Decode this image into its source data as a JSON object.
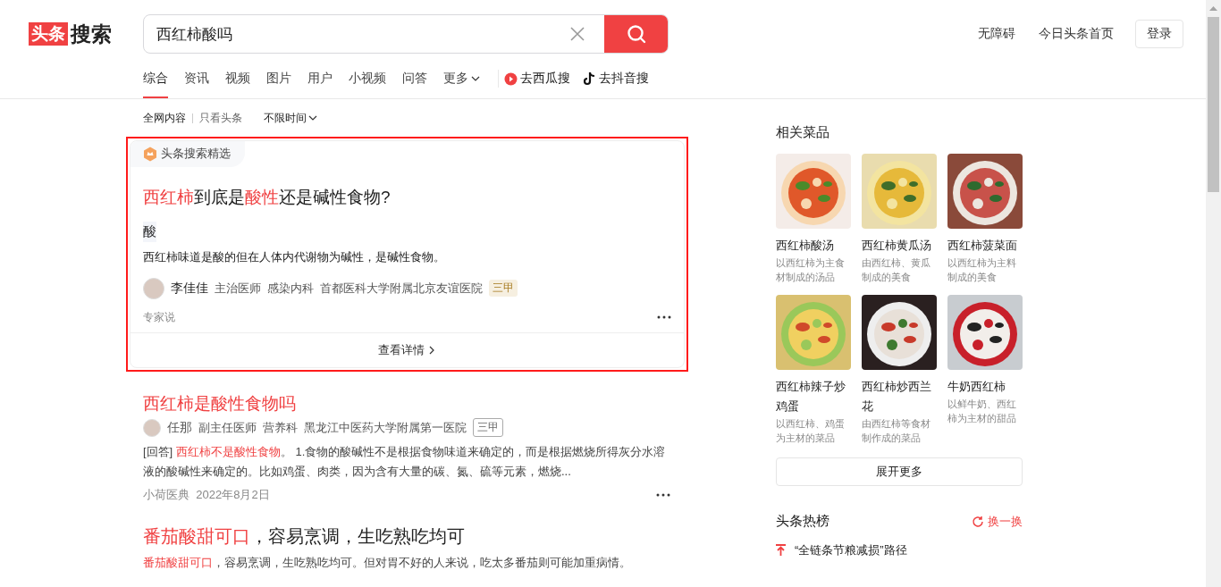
{
  "header": {
    "logo": {
      "badge": "头条",
      "text": "搜索"
    },
    "search": {
      "value": "西红柿酸吗"
    },
    "links": [
      "无障碍",
      "今日头条首页"
    ],
    "login": "登录"
  },
  "tabs": [
    {
      "label": "综合",
      "selected": true,
      "kind": "plain"
    },
    {
      "label": "资讯",
      "selected": false,
      "kind": "plain"
    },
    {
      "label": "视频",
      "selected": false,
      "kind": "plain"
    },
    {
      "label": "图片",
      "selected": false,
      "kind": "plain"
    },
    {
      "label": "用户",
      "selected": false,
      "kind": "plain"
    },
    {
      "label": "小视频",
      "selected": false,
      "kind": "plain"
    },
    {
      "label": "问答",
      "selected": false,
      "kind": "plain"
    },
    {
      "label": "更多",
      "selected": false,
      "kind": "dropdown"
    }
  ],
  "external_links": [
    {
      "label": "去西瓜搜",
      "kind": "xigua"
    },
    {
      "label": "去抖音搜",
      "kind": "douyin"
    }
  ],
  "filters": [
    {
      "label": "全网内容",
      "selected": true
    },
    {
      "label": "只看头条",
      "selected": false
    }
  ],
  "time_filter": "不限时间",
  "featured": {
    "highlighted": true,
    "badge": "头条搜索精选",
    "title": [
      {
        "text": "西红柿",
        "highlight": true
      },
      {
        "text": "到底是",
        "highlight": false
      },
      {
        "text": "酸性",
        "highlight": true
      },
      {
        "text": "还是碱性食物?",
        "highlight": false
      }
    ],
    "answer": "酸",
    "summary": "西红柿味道是酸的但在人体内代谢物为碱性，是碱性食物。",
    "author": {
      "name": "李佳佳",
      "title": "主治医师",
      "dept": "感染内科",
      "hospital": "首都医科大学附属北京友谊医院",
      "grade": "三甲"
    },
    "source": "专家说",
    "more": "查看详情"
  },
  "results": [
    {
      "kind": "answer",
      "title": [
        {
          "text": "西红柿是酸性食物吗",
          "highlight": true
        }
      ],
      "author": {
        "name": "任那",
        "title": "副主任医师",
        "dept": "营养科",
        "hospital": "黑龙江中医药大学附属第一医院",
        "grade": "三甲"
      },
      "snippet": [
        {
          "text": "[回答] ",
          "highlight": false
        },
        {
          "text": "西红柿不是酸性食物",
          "highlight": true
        },
        {
          "text": "。 1.食物的酸碱性不是根据食物味道来确定的，而是根据燃烧所得灰分水溶液的酸碱性来确定的。比如鸡蛋、肉类，因为含有大量的碳、氮、硫等元素，燃烧...",
          "highlight": false
        }
      ],
      "source": "小荷医典",
      "date": "2022年8月2日"
    },
    {
      "kind": "article",
      "title": [
        {
          "text": "番茄酸甜可口",
          "highlight": true
        },
        {
          "text": "，容易烹调，生吃熟吃均可",
          "highlight": false
        }
      ],
      "snippet": [
        {
          "text": "番茄酸甜可口",
          "highlight": true
        },
        {
          "text": "，容易烹调，生吃熟吃均可。但对胃不好的人来说，吃太多番茄则可能加重病情。",
          "highlight": false
        }
      ]
    }
  ],
  "dishes": {
    "title": "相关菜品",
    "items": [
      {
        "name": "西红柿酸汤",
        "desc": "以西红柿为主食材制成的汤品",
        "kind": "picture"
      },
      {
        "name": "西红柿黄瓜汤",
        "desc": "由西红柿、黄瓜制成的美食",
        "kind": "picture"
      },
      {
        "name": "西红柿菠菜面",
        "desc": "以西红柿为主料制成的美食",
        "kind": "picture"
      },
      {
        "name": "西红柿辣子炒鸡蛋",
        "desc": "以西红柿、鸡蛋为主材的菜品",
        "kind": "picture"
      },
      {
        "name": "西红柿炒西兰花",
        "desc": "由西红柿等食材制作成的菜品",
        "kind": "picture"
      },
      {
        "name": "牛奶西红柿",
        "desc": "以鲜牛奶、西红柿为主材的甜品",
        "kind": "picture"
      }
    ],
    "more": "展开更多"
  },
  "hot": {
    "title": "头条热榜",
    "refresh": "换一换",
    "items": [
      {
        "kind": "pinned",
        "text": "“全链条节粮减损”路径"
      }
    ]
  }
}
